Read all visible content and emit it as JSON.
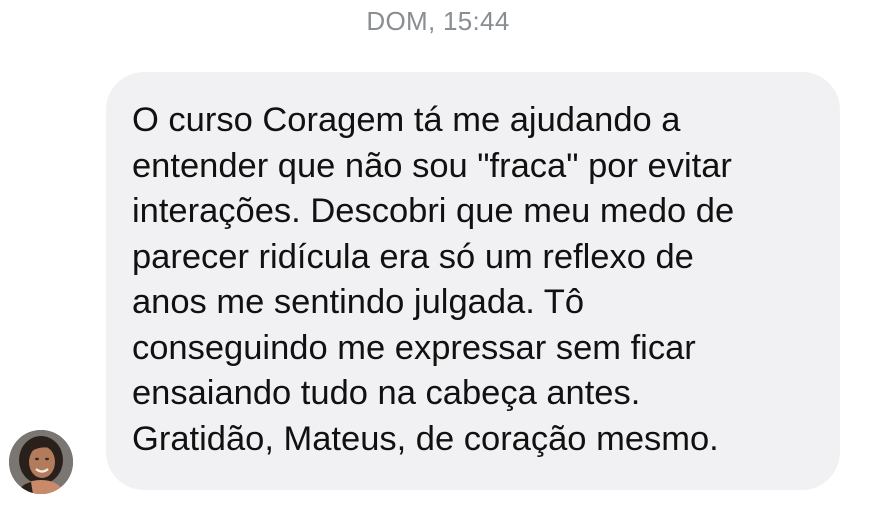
{
  "thread": {
    "timestamp": "DOM, 15:44"
  },
  "message": {
    "text": "O curso Coragem tá me ajudando a\nentender que não sou \"fraca\" por evitar\ninterações. Descobri que meu medo de\nparecer ridícula era só um reflexo de\nanos me sentindo julgada. Tô\nconseguindo me expressar sem ficar\nensaiando tudo na cabeça antes.\nGratidão, Mateus, de coração mesmo."
  },
  "colors": {
    "bubble_background": "#f1f1f3",
    "timestamp": "#8a8d91",
    "text": "#111111"
  }
}
